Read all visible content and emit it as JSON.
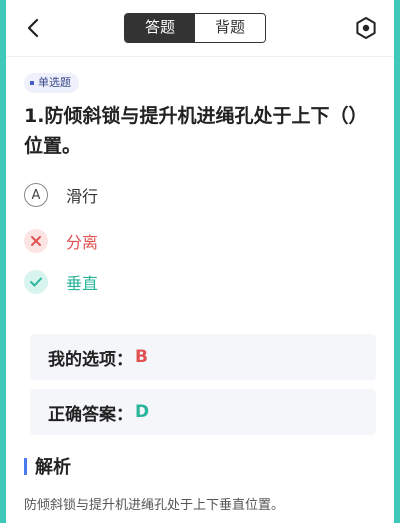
{
  "header": {
    "tabs": [
      {
        "label": "答题",
        "active": true
      },
      {
        "label": "背题",
        "active": false
      }
    ]
  },
  "question": {
    "type_badge": "单选题",
    "text": "1.防倾斜锁与提升机进绳孔处于上下（）位置。",
    "options": [
      {
        "mark": "A",
        "text": "滑行",
        "state": "plain"
      },
      {
        "mark": "",
        "text": "分离",
        "state": "wrong",
        "icon": "close-icon"
      },
      {
        "mark": "",
        "text": "垂直",
        "state": "right",
        "icon": "check-icon"
      }
    ]
  },
  "my_answer": {
    "label": "我的选项：",
    "value": "B"
  },
  "correct_answer": {
    "label": "正确答案：",
    "value": "D"
  },
  "analysis": {
    "title": "解析",
    "text": "防倾斜锁与提升机进绳孔处于上下垂直位置。"
  },
  "colors": {
    "accent_edge": "#3fc9b8",
    "wrong": "#e05252",
    "right": "#2ab49b",
    "section_bar": "#4a7cf0"
  }
}
